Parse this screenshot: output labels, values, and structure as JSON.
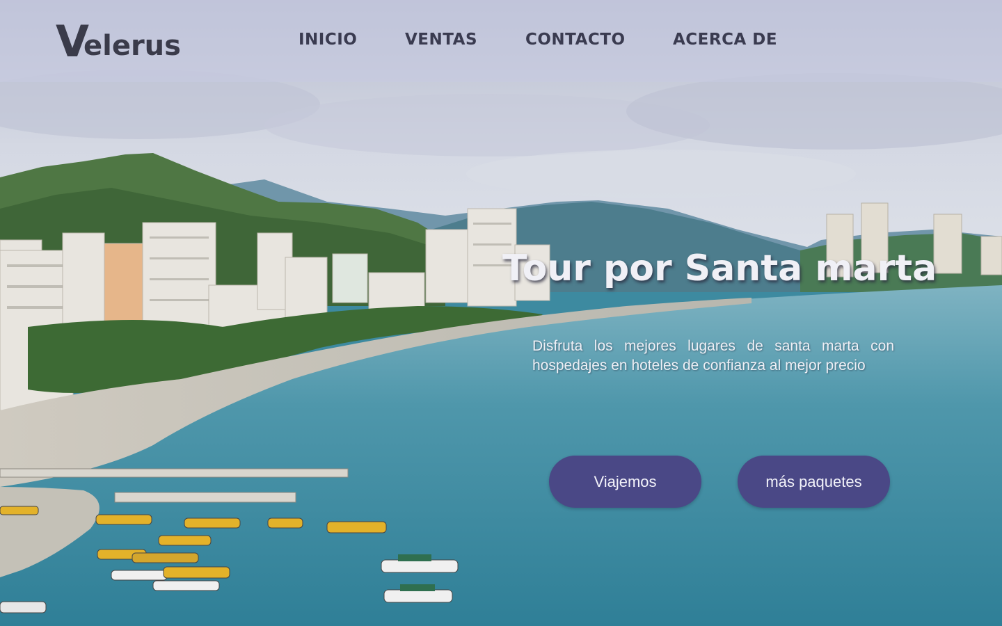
{
  "brand": {
    "logo_initial": "V",
    "logo_rest": "elerus"
  },
  "nav": {
    "items": [
      {
        "label": "INICIO"
      },
      {
        "label": "VENTAS"
      },
      {
        "label": "CONTACTO"
      },
      {
        "label": "ACERCA DE"
      }
    ]
  },
  "hero": {
    "title": "Tour por Santa marta",
    "description": "Disfruta los mejores lugares de santa marta con hospedajes en hoteles de confianza al mejor precio",
    "buttons": {
      "primary_label": "Viajemos",
      "secondary_label": "más paquetes"
    }
  },
  "colors": {
    "navbar_bg": "#c6cae0",
    "nav_text": "#3a3b50",
    "button_bg": "#4a4886",
    "button_text": "#f3f3fa",
    "sea": "#3d8aa0",
    "sky": "#c9cedd"
  },
  "icons": {
    "logo": "sail-v-logo"
  }
}
